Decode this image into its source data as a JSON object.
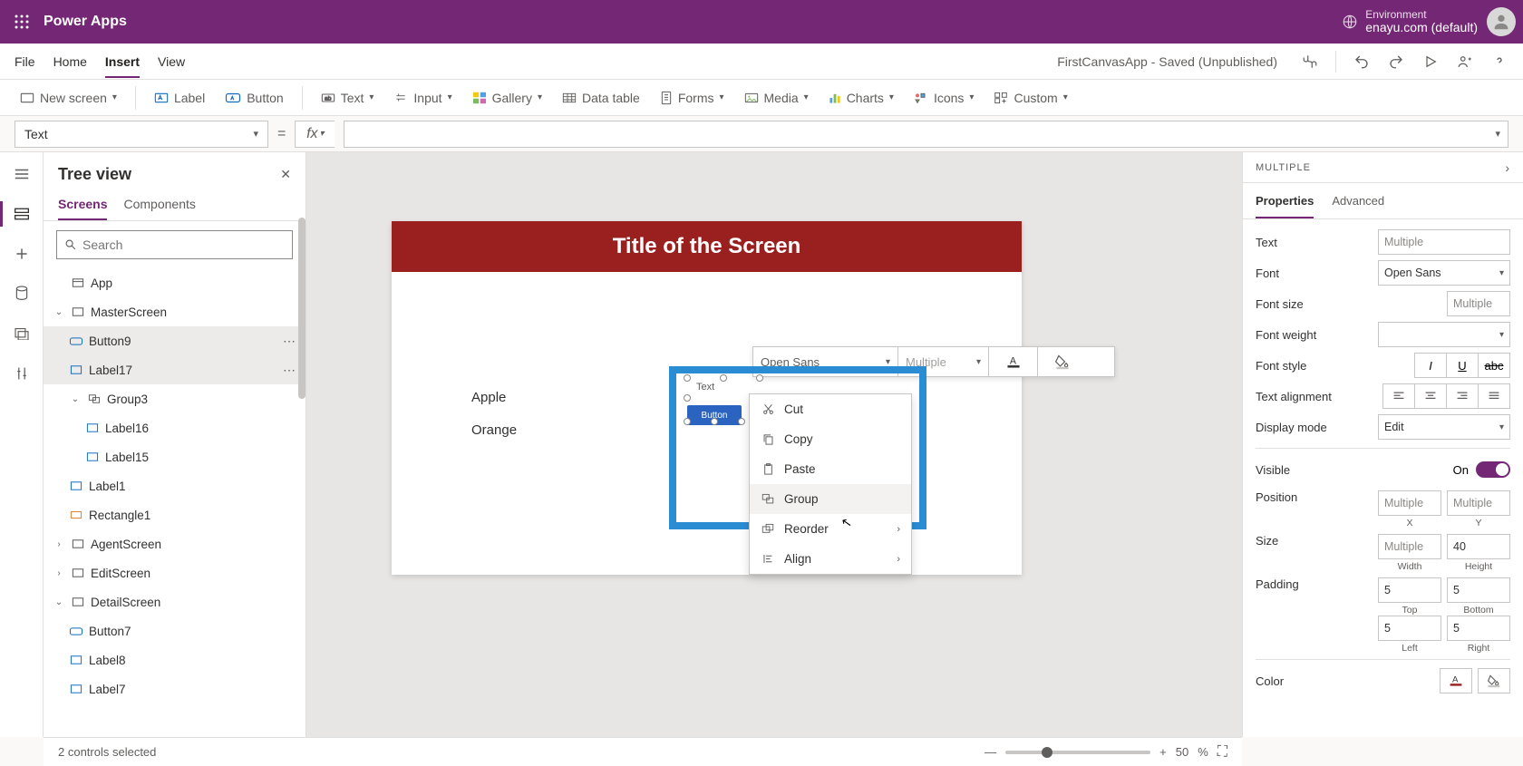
{
  "header": {
    "app_title": "Power Apps",
    "env_label": "Environment",
    "env_value": "enayu.com (default)"
  },
  "menu": {
    "items": [
      "File",
      "Home",
      "Insert",
      "View"
    ],
    "active": "Insert",
    "status": "FirstCanvasApp - Saved (Unpublished)"
  },
  "ribbon": {
    "new_screen": "New screen",
    "label": "Label",
    "button": "Button",
    "text": "Text",
    "input": "Input",
    "gallery": "Gallery",
    "data_table": "Data table",
    "forms": "Forms",
    "media": "Media",
    "charts": "Charts",
    "icons": "Icons",
    "custom": "Custom"
  },
  "formula": {
    "property": "Text",
    "fx": "fx",
    "value": ""
  },
  "tree": {
    "title": "Tree view",
    "tabs": {
      "screens": "Screens",
      "components": "Components"
    },
    "search_placeholder": "Search",
    "nodes": {
      "app": "App",
      "master": "MasterScreen",
      "button9": "Button9",
      "label17": "Label17",
      "group3": "Group3",
      "label16": "Label16",
      "label15": "Label15",
      "label1": "Label1",
      "rect1": "Rectangle1",
      "agent": "AgentScreen",
      "edit": "EditScreen",
      "detail": "DetailScreen",
      "button7": "Button7",
      "label8": "Label8",
      "label7": "Label7"
    }
  },
  "canvas": {
    "title": "Title of the Screen",
    "apple": "Apple",
    "orange": "Orange",
    "sel_text": "Text",
    "sel_button": "Button"
  },
  "fmtbar": {
    "font": "Open Sans",
    "size_placeholder": "Multiple"
  },
  "ctx": {
    "cut": "Cut",
    "copy": "Copy",
    "paste": "Paste",
    "group": "Group",
    "reorder": "Reorder",
    "align": "Align"
  },
  "props": {
    "section": "MULTIPLE",
    "tabs": {
      "properties": "Properties",
      "advanced": "Advanced"
    },
    "text_label": "Text",
    "text_value": "Multiple",
    "font_label": "Font",
    "font_value": "Open Sans",
    "fontsize_label": "Font size",
    "fontsize_value": "Multiple",
    "fontweight_label": "Font weight",
    "fontstyle_label": "Font style",
    "align_label": "Text alignment",
    "display_label": "Display mode",
    "display_value": "Edit",
    "visible_label": "Visible",
    "visible_value": "On",
    "position_label": "Position",
    "pos_x": "Multiple",
    "pos_y": "Multiple",
    "pos_x_l": "X",
    "pos_y_l": "Y",
    "size_label": "Size",
    "size_w": "Multiple",
    "size_h": "40",
    "size_w_l": "Width",
    "size_h_l": "Height",
    "padding_label": "Padding",
    "pad_t": "5",
    "pad_b": "5",
    "pad_l": "5",
    "pad_r": "5",
    "pad_t_l": "Top",
    "pad_b_l": "Bottom",
    "pad_l_l": "Left",
    "pad_r_l": "Right",
    "color_label": "Color"
  },
  "status": {
    "selection": "2 controls selected",
    "zoom_value": "50",
    "zoom_pct": "%"
  }
}
